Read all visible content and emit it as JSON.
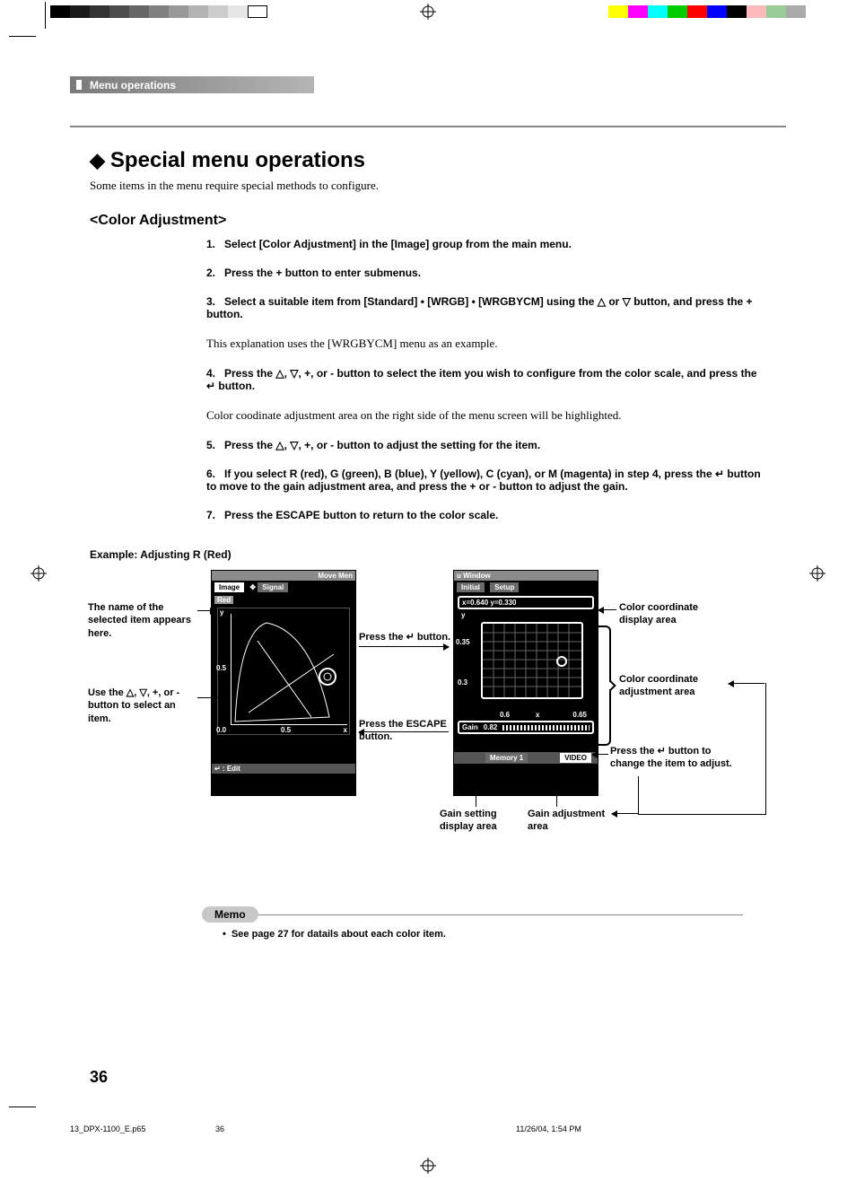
{
  "header": {
    "breadcrumb": "Menu operations"
  },
  "section": {
    "title": "Special menu operations",
    "intro": "Some items in the menu require special methods to configure."
  },
  "color_adjustment": {
    "heading": "<Color Adjustment>",
    "steps": [
      "Select [Color Adjustment] in the [Image] group from the main menu.",
      "Press the + button to enter submenus.",
      "Select a suitable item from [Standard] • [WRGB] • [WRGBYCM] using the △ or ▽ button, and press the + button.",
      "Press the △, ▽, +, or - button to select the item you wish to configure from the color scale, and press the ↵ button.",
      "Press the △, ▽, +, or - button to adjust the setting for the item.",
      "If you select  R (red), G (green), B (blue), Y (yellow), C (cyan), or M (magenta) in step 4, press the ↵ button to move to the gain adjustment area, and press the + or - button to adjust the gain.",
      "Press the ESCAPE button to return to the color scale."
    ],
    "notes": {
      "after3": "This explanation uses the [WRGBYCM] menu as an example.",
      "after4": "Color coodinate adjustment area on the right side of the menu screen will be highlighted."
    }
  },
  "example": {
    "title": "Example: Adjusting R (Red)",
    "left_label_name": "The name of the selected item appears here.",
    "left_label_use": "Use the △, ▽, +, or - button to select an item.",
    "press_enter": "Press the ↵ button.",
    "press_escape": "Press the ESCAPE button.",
    "coord_display": "Color coordinate display area",
    "coord_adjust": "Color coordinate adjustment area",
    "press_enter_change": "Press the ↵ button to change the item to adjust.",
    "gain_display": "Gain setting display area",
    "gain_adjust": "Gain adjustment area"
  },
  "mock_left": {
    "move": "Move Men",
    "tab1": "Image",
    "tab2": "Signal",
    "item": "Red",
    "y": "y",
    "x": "x",
    "t05a": "0.5",
    "t00": "0.0",
    "t05b": "0.5",
    "edit": "↵ : Edit"
  },
  "mock_right": {
    "win": "u Window",
    "tab1": "Initial",
    "tab2": "Setup",
    "coord": "x=0.640    y=0.330",
    "y": "y",
    "x": "x",
    "t035": "0.35",
    "t03": "0.3",
    "t06": "0.6",
    "t065": "0.65",
    "gain": "Gain",
    "gain_val": "0.82",
    "mem": "Memory 1",
    "video": "VIDEO"
  },
  "memo": {
    "label": "Memo",
    "bullet": "See page 27 for datails about each color item."
  },
  "page_number": "36",
  "footer": {
    "file": "13_DPX-1100_E.p65",
    "page": "36",
    "date": "11/26/04, 1:54 PM"
  },
  "print_colors_left": [
    "#000",
    "#1a1a1a",
    "#333",
    "#4d4d4d",
    "#666",
    "#808080",
    "#999",
    "#b3b3b3",
    "#ccc",
    "#e6e6e6",
    "#fff"
  ],
  "print_colors_right": [
    "#ff0",
    "#f0f",
    "#0ff",
    "#0f0",
    "#f00",
    "#00f",
    "#000",
    "#fbb",
    "#9c9",
    "#aaa"
  ]
}
